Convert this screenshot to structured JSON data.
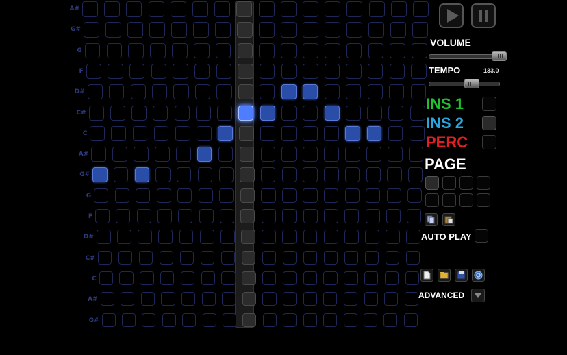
{
  "notes": [
    "A#",
    "G#",
    "G",
    "F",
    "D#",
    "C#",
    "C",
    "A#",
    "G#",
    "G",
    "F",
    "D#",
    "C#",
    "C",
    "A#",
    "G#"
  ],
  "steps": 16,
  "current_step": 7,
  "active_cells": [
    [
      4,
      9
    ],
    [
      4,
      10
    ],
    [
      5,
      7
    ],
    [
      5,
      8
    ],
    [
      5,
      11
    ],
    [
      6,
      6
    ],
    [
      6,
      12
    ],
    [
      6,
      13
    ],
    [
      7,
      5
    ],
    [
      8,
      0
    ],
    [
      8,
      2
    ]
  ],
  "transport": {
    "play_icon": "play-icon",
    "pause_icon": "pause-icon"
  },
  "volume": {
    "label": "VOLUME",
    "level": 0.92
  },
  "tempo": {
    "label": "TEMPO",
    "value": "133.0",
    "level": 0.5
  },
  "instruments": [
    {
      "label": "INS 1",
      "color": "#1fbf2e",
      "selected": false
    },
    {
      "label": "INS 2",
      "color": "#27a6e0",
      "selected": true
    },
    {
      "label": "PERC",
      "color": "#e02020",
      "selected": false
    }
  ],
  "page": {
    "label": "PAGE",
    "count": 8,
    "selected_index": 0
  },
  "clipboard": {
    "copy_icon": "copy-icon",
    "paste_icon": "paste-icon"
  },
  "auto_play": {
    "label": "AUTO PLAY",
    "checked": false
  },
  "file_actions": [
    "new-file-icon",
    "open-folder-icon",
    "save-disk-icon",
    "help-icon"
  ],
  "advanced": {
    "label": "ADVANCED",
    "icon": "triangle-down-icon"
  }
}
